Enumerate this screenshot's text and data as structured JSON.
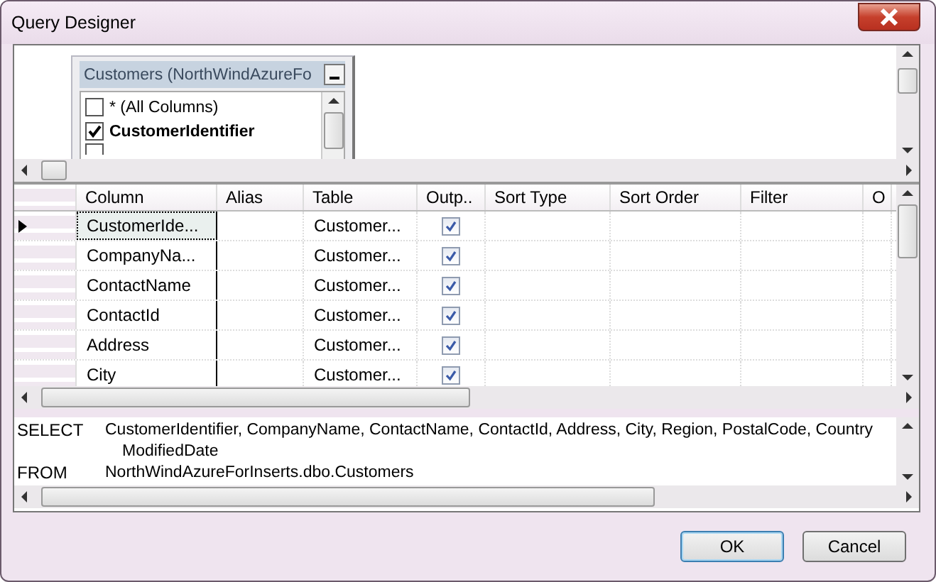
{
  "window": {
    "title": "Query Designer"
  },
  "diagram": {
    "table": {
      "title": "Customers (NorthWindAzureFo",
      "columns": [
        {
          "name": "* (All Columns)",
          "checked": false
        },
        {
          "name": "CustomerIdentifier",
          "checked": true
        }
      ]
    }
  },
  "grid": {
    "columns": [
      "Column",
      "Alias",
      "Table",
      "Outp..",
      "Sort Type",
      "Sort Order",
      "Filter",
      "O"
    ],
    "rows": [
      {
        "column": "CustomerIde...",
        "table": "Customer...",
        "output": true,
        "current": true
      },
      {
        "column": "CompanyNa...",
        "table": "Customer...",
        "output": true,
        "current": false
      },
      {
        "column": "ContactName",
        "table": "Customer...",
        "output": true,
        "current": false
      },
      {
        "column": "ContactId",
        "table": "Customer...",
        "output": true,
        "current": false
      },
      {
        "column": "Address",
        "table": "Customer...",
        "output": true,
        "current": false
      },
      {
        "column": "City",
        "table": "Customer...",
        "output": true,
        "current": false
      }
    ]
  },
  "sql": [
    {
      "keyword": "SELECT",
      "lines": [
        "CustomerIdentifier, CompanyName, ContactName, ContactId, Address, City, Region, PostalCode, Country",
        "ModifiedDate"
      ]
    },
    {
      "keyword": "FROM",
      "lines": [
        "NorthWindAzureForInserts.dbo.Customers"
      ]
    }
  ],
  "buttons": [
    {
      "label": "OK",
      "default": true
    },
    {
      "label": "Cancel",
      "default": false
    }
  ]
}
